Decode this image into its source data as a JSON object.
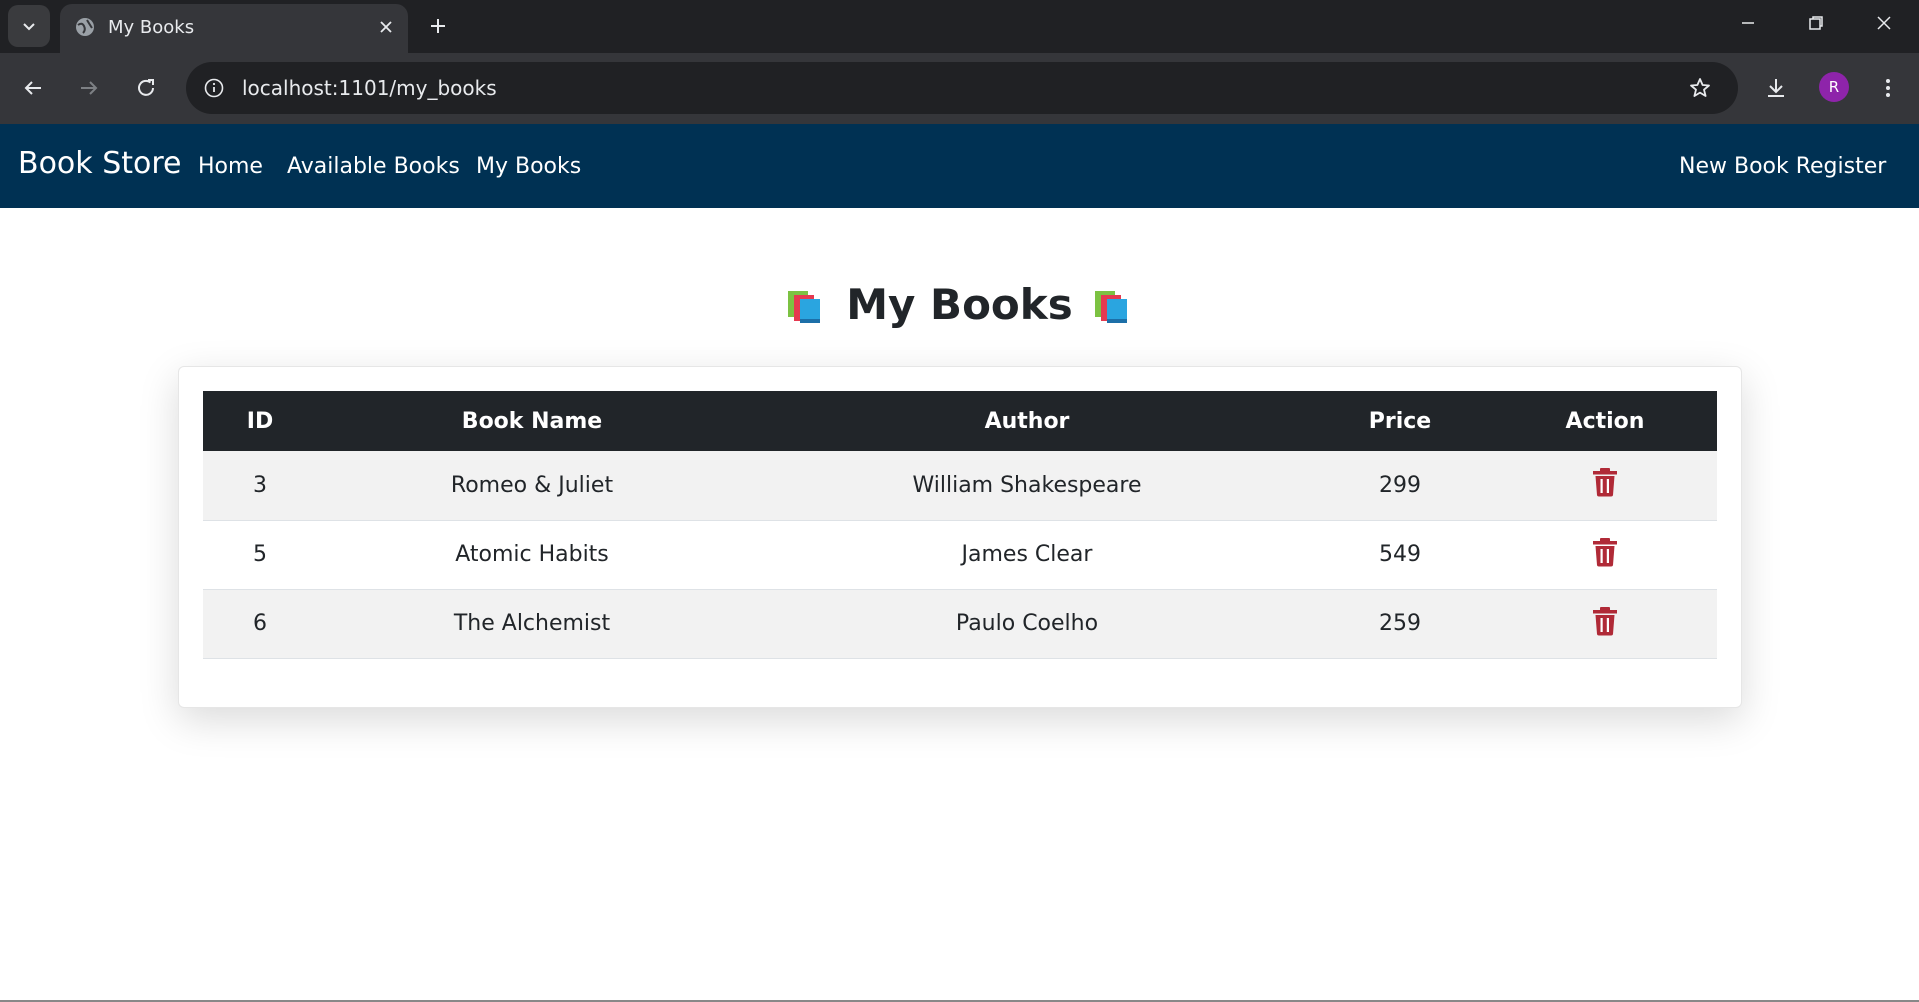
{
  "browser": {
    "tab_title": "My Books",
    "url": "localhost:1101/my_books",
    "profile_initial": "R"
  },
  "navbar": {
    "brand": "Book Store",
    "links": [
      "Home",
      "Available Books",
      "My Books"
    ],
    "register": "New Book Register",
    "bg_color": "#003153"
  },
  "page": {
    "heading": "My Books"
  },
  "table": {
    "headers": [
      "ID",
      "Book Name",
      "Author",
      "Price",
      "Action"
    ],
    "rows": [
      {
        "id": "3",
        "name": "Romeo & Juliet",
        "author": "William Shakespeare",
        "price": "299"
      },
      {
        "id": "5",
        "name": "Atomic Habits",
        "author": "James Clear",
        "price": "549"
      },
      {
        "id": "6",
        "name": "The Alchemist",
        "author": "Paulo Coelho",
        "price": "259"
      }
    ],
    "action_icon": "trash-icon",
    "action_color": "#b02a37"
  }
}
